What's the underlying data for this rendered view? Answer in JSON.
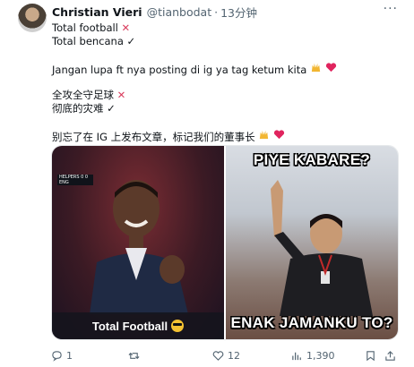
{
  "author": {
    "name": "Christian Vieri",
    "handle": "@tianbodat",
    "separator": "·",
    "time": "13分钟"
  },
  "more_label": "···",
  "text": {
    "line1": "Total football",
    "line2": "Total bencana",
    "line3": "Jangan lupa ft nya posting di ig ya tag ketum kita",
    "line4": "全攻全守足球",
    "line5": "彻底的灾难",
    "line6": "别忘了在 IG 上发布文章，标记我们的董事长"
  },
  "glyphs": {
    "cross": "✕",
    "check": "✓"
  },
  "media": {
    "left_caption": "Total Football",
    "left_scoreboard": "HELPERS 0 0 ENG",
    "right_top": "PIYE KABARE?",
    "right_bottom": "ENAK JAMANKU TO?"
  },
  "actions": {
    "replies": "1",
    "retweets": "",
    "likes": "12",
    "views": "1,390"
  },
  "colors": {
    "text": "#0f1419",
    "muted": "#536471",
    "cross": "#d93b5c",
    "heart": "#e0245e"
  },
  "icons": [
    "reply-icon",
    "retweet-icon",
    "like-icon",
    "views-icon",
    "bookmark-icon",
    "share-icon",
    "more-icon"
  ]
}
